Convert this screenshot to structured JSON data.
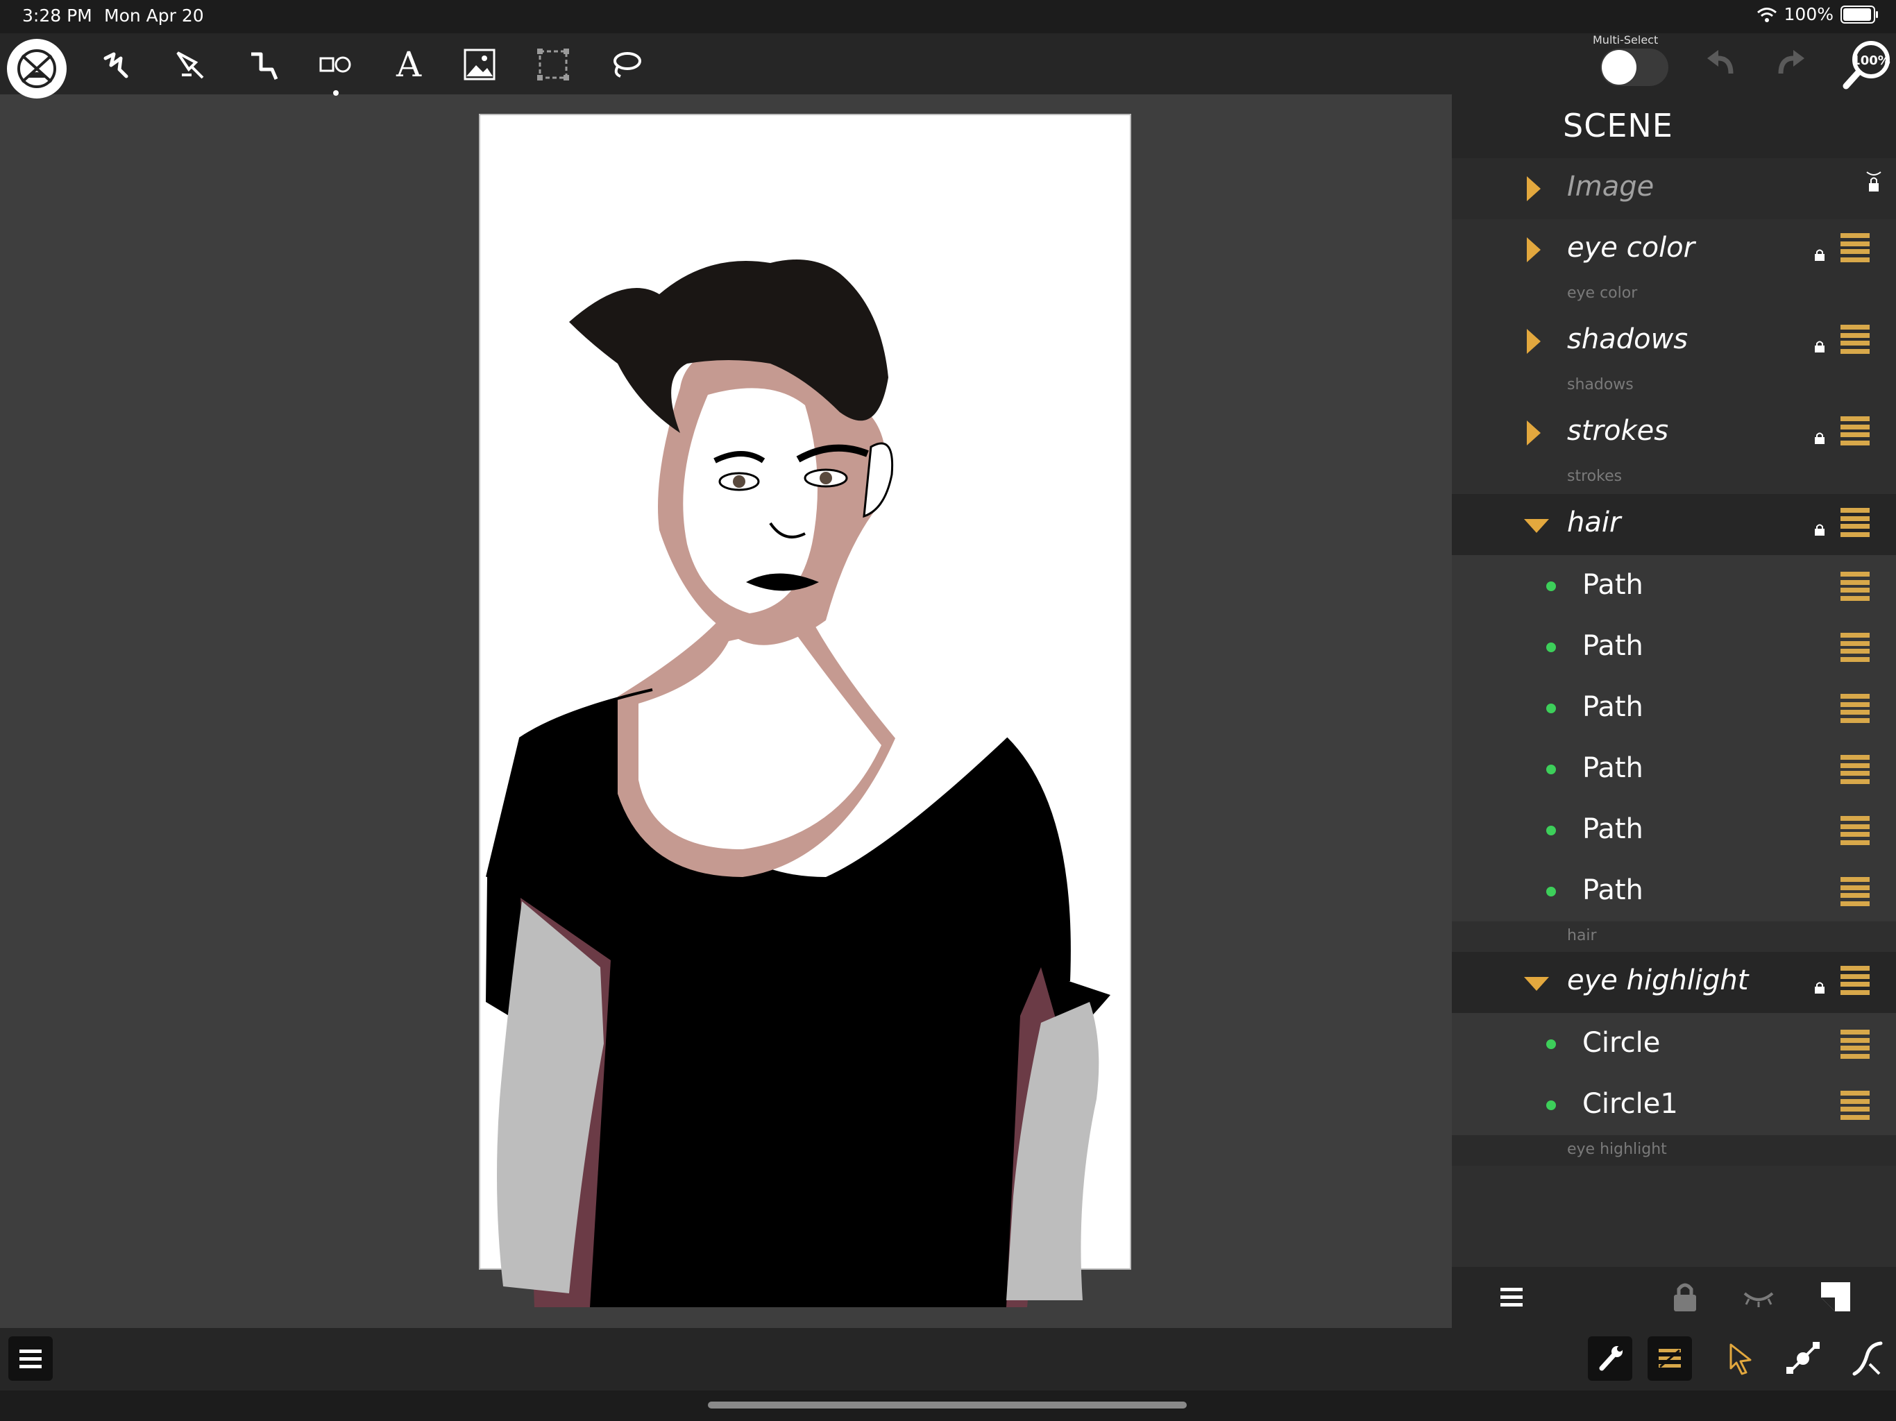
{
  "status_bar": {
    "time": "3:28 PM",
    "date": "Mon Apr 20",
    "battery_text": "100%",
    "battery_level": 1.0,
    "icons": [
      "wifi-icon",
      "battery-icon"
    ]
  },
  "toolbar": {
    "tools": [
      "app-menu-icon",
      "freehand-icon",
      "pen-icon",
      "bezigon-icon",
      "shapes-icon",
      "text-icon",
      "image-icon",
      "crop-icon",
      "lasso-icon"
    ],
    "multi_select_label": "Multi-Select",
    "multi_select_on": false,
    "zoom_label": "100%"
  },
  "scene": {
    "title": "SCENE",
    "layers": [
      {
        "name": "Image",
        "expanded": false,
        "sublabel": ""
      },
      {
        "name": "eye color",
        "expanded": false,
        "sublabel": "eye color"
      },
      {
        "name": "shadows",
        "expanded": false,
        "sublabel": "shadows"
      },
      {
        "name": "strokes",
        "expanded": false,
        "sublabel": "strokes"
      },
      {
        "name": "hair",
        "expanded": true,
        "sublabel": "hair",
        "children": [
          "Path",
          "Path",
          "Path",
          "Path",
          "Path",
          "Path"
        ]
      },
      {
        "name": "eye highlight",
        "expanded": true,
        "sublabel": "eye highlight",
        "children": [
          "Circle",
          "Circle1"
        ]
      }
    ]
  },
  "colors": {
    "accent": "#e3a83e",
    "child_dot": "#3dcf5a",
    "panel_bg": "#2f2f2f",
    "toolbar_bg": "#262626",
    "canvas_bg": "#3e3e3e"
  }
}
